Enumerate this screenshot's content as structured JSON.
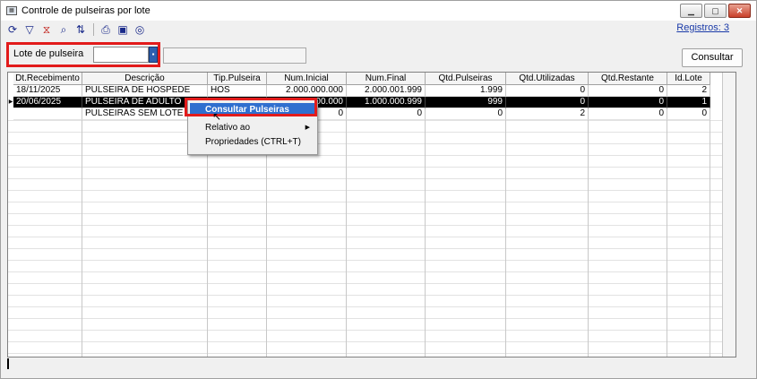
{
  "window": {
    "title": "Controle de pulseiras por lote",
    "app_icon": "app-icon",
    "controls": [
      "minimize-icon",
      "maximize-icon",
      "close-icon"
    ]
  },
  "toolbar": {
    "icons": [
      "refresh-icon",
      "filter-icon",
      "clear-filter-icon",
      "search-icon",
      "sort-icon",
      "print-icon",
      "save-icon",
      "ia-icon"
    ],
    "registros": "Registros: 3"
  },
  "filter": {
    "label": "Lote de pulseira",
    "value": "",
    "description_value": ""
  },
  "buttons": {
    "consultar": "Consultar"
  },
  "grid": {
    "columns": [
      "Dt.Recebimento",
      "Descrição",
      "Tip.Pulseira",
      "Num.Inicial",
      "Num.Final",
      "Qtd.Pulseiras",
      "Qtd.Utilizadas",
      "Qtd.Restante",
      "Id.Lote"
    ],
    "rows": [
      [
        "18/11/2025",
        "PULSEIRA DE HOSPEDE",
        "HOS",
        "2.000.000.000",
        "2.000.001.999",
        "1.999",
        "0",
        "0",
        "2"
      ],
      [
        "20/06/2025",
        "PULSEIRA DE ADULTO",
        "",
        "1.000.000.000",
        "1.000.000.999",
        "999",
        "0",
        "0",
        "1"
      ],
      [
        "",
        "PULSEIRAS SEM LOTE",
        "",
        "0",
        "0",
        "0",
        "2",
        "0",
        "0"
      ]
    ],
    "selected_row": 1
  },
  "context_menu": {
    "items": [
      {
        "label": "Consultar Pulseiras",
        "highlighted": true
      },
      {
        "label": "Relativo ao",
        "submenu": true
      },
      {
        "label": "Propriedades (CTRL+T)"
      }
    ]
  },
  "colors": {
    "highlight_frame": "#e21b1b",
    "menu_highlight": "#2f6fcf",
    "selected_row": "#000000",
    "link": "#1a3aa8"
  }
}
